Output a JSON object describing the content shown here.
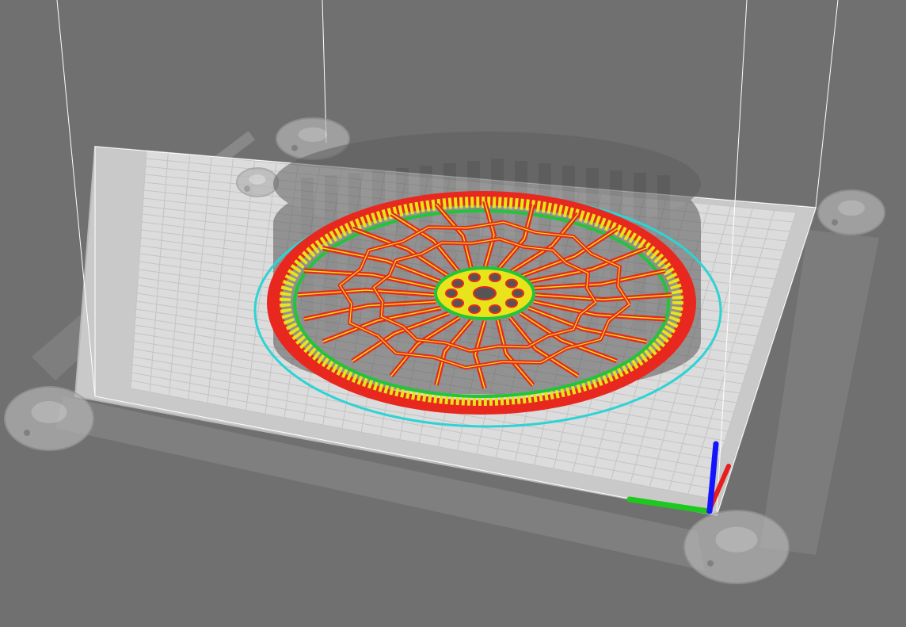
{
  "viewport": {
    "kind": "3d-slicer-layer-preview",
    "background_color": "#707070",
    "bed_color": "#dcdcdc",
    "grid_color": "#c4c4c4",
    "frame_color": "#9a9a9a",
    "ghost_model_color": "#5a5a5a",
    "skirt_color": "#2fd3d3"
  },
  "print_layer": {
    "outer_perimeter_color": "#e8281e",
    "solid_fill_color": "#e8e31a",
    "center_hub_color": "#e8e31a",
    "wall_color": "#22c43a",
    "spoke_count": 24
  },
  "axes": {
    "x_color": "#1ec81e",
    "y_color": "#e81e1e",
    "z_color": "#1414ff"
  },
  "printer_parts": {
    "corner_clips": [
      {
        "name": "bed-clip-back-left-icon"
      },
      {
        "name": "bed-clip-back-right-icon"
      },
      {
        "name": "bed-clip-front-left-icon"
      },
      {
        "name": "bed-clip-front-right-icon"
      },
      {
        "name": "bed-clip-left-mid-icon"
      }
    ]
  }
}
